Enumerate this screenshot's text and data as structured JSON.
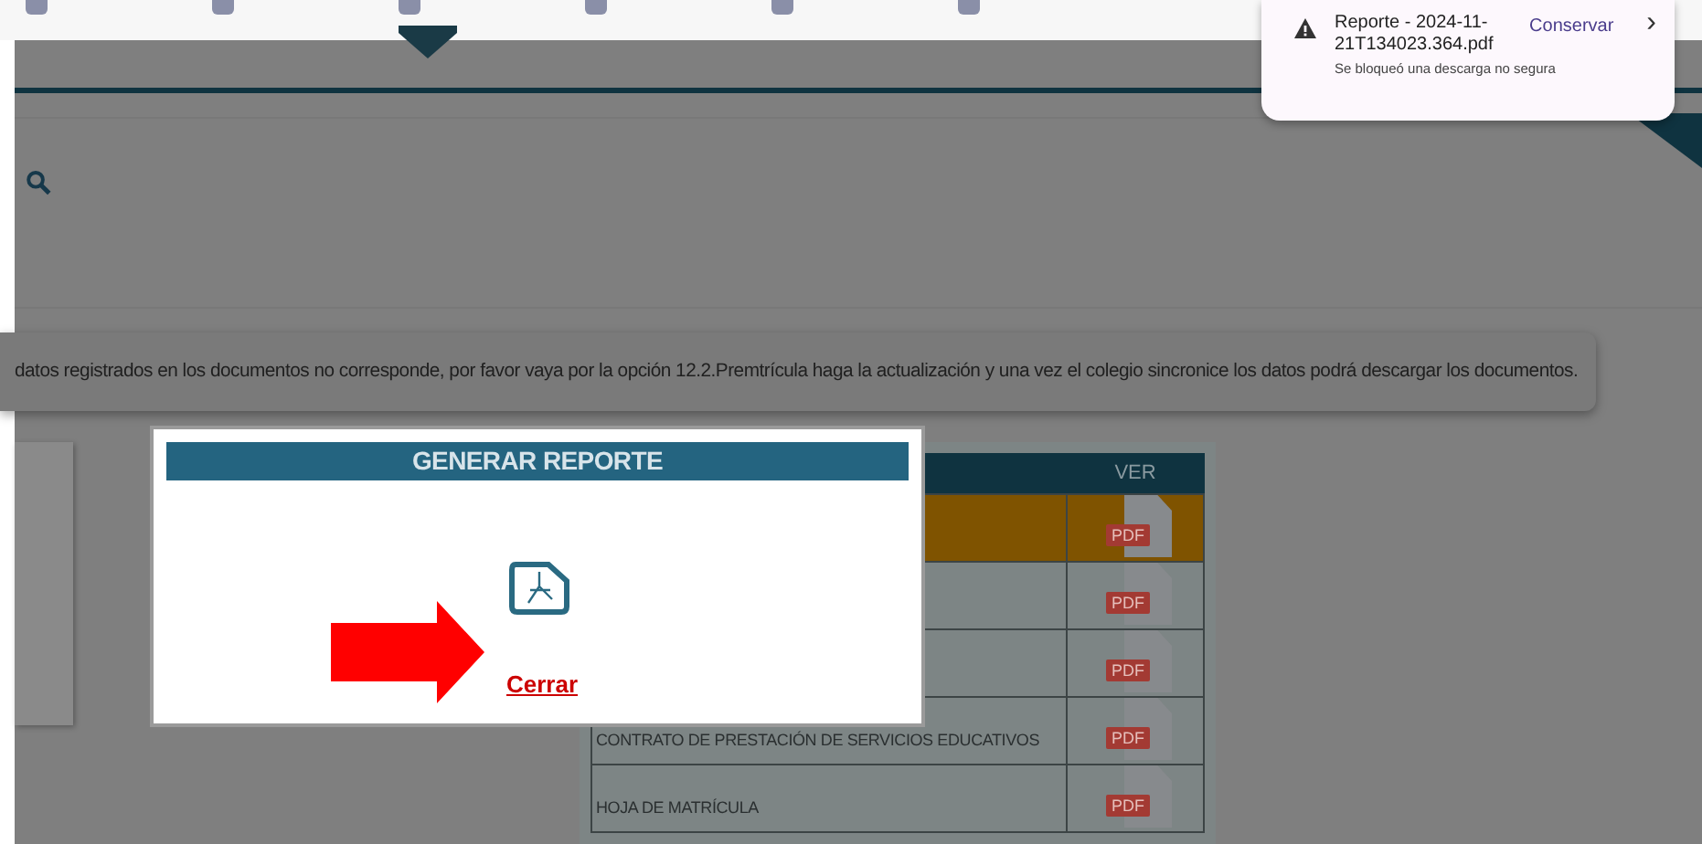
{
  "download_popup": {
    "file": "Reporte - 2024-11-21T134023.364.pdf",
    "action": "Conservar",
    "chevron": "›",
    "message": "Se bloqueó una descarga no segura"
  },
  "banner": {
    "text": "datos registrados en los documentos no corresponde, por favor vaya por la opción 12.2.Premtrícula haga la actualización y una vez el colegio sincronice los datos podrá descargar los documentos."
  },
  "table": {
    "columns": [
      "VER"
    ],
    "rows": [
      {
        "document": "",
        "selected": true,
        "pdf": "PDF"
      },
      {
        "document": "",
        "selected": false,
        "pdf": "PDF"
      },
      {
        "document": "",
        "selected": false,
        "pdf": "PDF"
      },
      {
        "document": "CONTRATO DE PRESTACIÓN DE SERVICIOS EDUCATIVOS",
        "selected": false,
        "pdf": "PDF"
      },
      {
        "document": "HOJA DE MATRÍCULA",
        "selected": false,
        "pdf": "PDF"
      }
    ]
  },
  "modal": {
    "title": "GENERAR REPORTE",
    "link": "Cerrar"
  }
}
